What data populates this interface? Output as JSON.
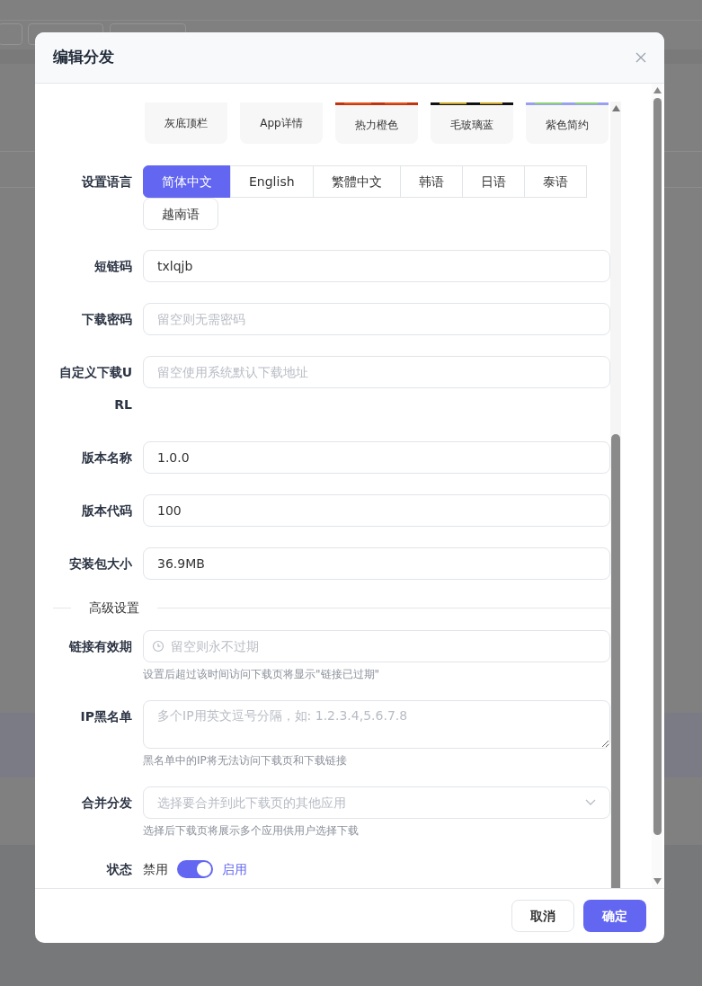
{
  "dialog": {
    "title": "编辑分发"
  },
  "themes": [
    {
      "label": "灰底顶栏"
    },
    {
      "label": "App详情"
    },
    {
      "label": "热力橙色"
    },
    {
      "label": "毛玻璃蓝"
    },
    {
      "label": "紫色简约"
    }
  ],
  "fields": [
    {
      "kind": "language",
      "label": "设置语言",
      "options": [
        {
          "label": "简体中文",
          "selected": true
        },
        {
          "label": "English",
          "selected": false
        },
        {
          "label": "繁體中文",
          "selected": false
        },
        {
          "label": "韩语",
          "selected": false
        },
        {
          "label": "日语",
          "selected": false
        },
        {
          "label": "泰语",
          "selected": false
        },
        {
          "label": "越南语",
          "selected": false
        }
      ]
    },
    {
      "kind": "input",
      "label": "短链码",
      "value": "txlqjb"
    },
    {
      "kind": "input",
      "label": "下载密码",
      "placeholder": "留空则无需密码"
    },
    {
      "kind": "input",
      "label": "自定义下载URL",
      "placeholder": "留空使用系统默认下载地址"
    },
    {
      "kind": "input",
      "label": "版本名称",
      "value": "1.0.0"
    },
    {
      "kind": "input",
      "label": "版本代码",
      "value": "100"
    },
    {
      "kind": "input",
      "label": "安装包大小",
      "value": "36.9MB"
    },
    {
      "kind": "divider",
      "label": "高级设置"
    },
    {
      "kind": "date",
      "label": "链接有效期",
      "placeholder": "留空则永不过期",
      "help": "设置后超过该时间访问下载页将显示\"链接已过期\""
    },
    {
      "kind": "textarea",
      "label": "IP黑名单",
      "placeholder": "多个IP用英文逗号分隔，如: 1.2.3.4,5.6.7.8",
      "help": "黑名单中的IP将无法访问下载页和下载链接"
    },
    {
      "kind": "select",
      "label": "合并分发",
      "placeholder": "选择要合并到此下载页的其他应用",
      "help": "选择后下载页将展示多个应用供用户选择下载"
    },
    {
      "kind": "switch",
      "label": "状态",
      "off_label": "禁用",
      "on_label": "启用",
      "on": true
    }
  ],
  "buttons": [
    {
      "kind": "cancel",
      "label": "取消"
    },
    {
      "kind": "confirm",
      "label": "确定"
    }
  ]
}
